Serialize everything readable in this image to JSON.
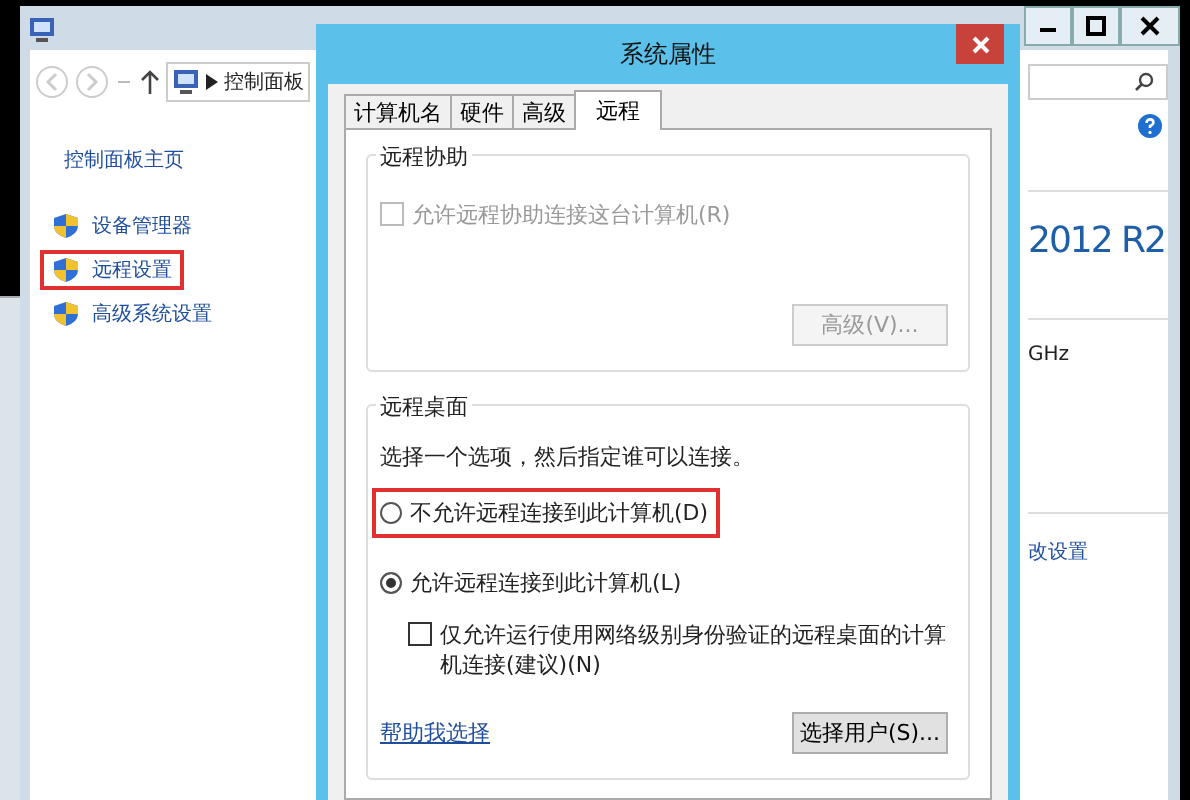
{
  "background_window": {
    "address": {
      "crumb": "控制面板"
    },
    "sidebar": {
      "home_link": "控制面板主页",
      "items": [
        {
          "label": "设备管理器",
          "highlighted": false
        },
        {
          "label": "远程设置",
          "highlighted": true
        },
        {
          "label": "高级系统设置",
          "highlighted": false
        }
      ]
    },
    "right_texts": [
      {
        "kind": "heading",
        "text": "2012 R2"
      },
      {
        "kind": "plain",
        "text": "GHz"
      },
      {
        "kind": "link",
        "text": "改设置"
      }
    ]
  },
  "dialog": {
    "title": "系统属性",
    "tabs": [
      {
        "label": "计算机名",
        "selected": false
      },
      {
        "label": "硬件",
        "selected": false
      },
      {
        "label": "高级",
        "selected": false
      },
      {
        "label": "远程",
        "selected": true
      }
    ],
    "remote_assistance": {
      "title": "远程协助",
      "checkbox": {
        "label": "允许远程协助连接这台计算机(R)",
        "checked": false,
        "disabled": true
      },
      "button": {
        "label": "高级(V)...",
        "disabled": true
      }
    },
    "remote_desktop": {
      "title": "远程桌面",
      "instruction": "选择一个选项，然后指定谁可以连接。",
      "options": [
        {
          "label": "不允许远程连接到此计算机(D)",
          "selected": false,
          "highlighted": true
        },
        {
          "label": "允许远程连接到此计算机(L)",
          "selected": true,
          "highlighted": false
        }
      ],
      "nla_checkbox": {
        "label": "仅允许运行使用网络级别身份验证的远程桌面的计算机连接(建议)(N)",
        "checked": false,
        "disabled": false
      },
      "help_link": "帮助我选择",
      "button": {
        "label": "选择用户(S)...",
        "disabled": false
      }
    }
  }
}
